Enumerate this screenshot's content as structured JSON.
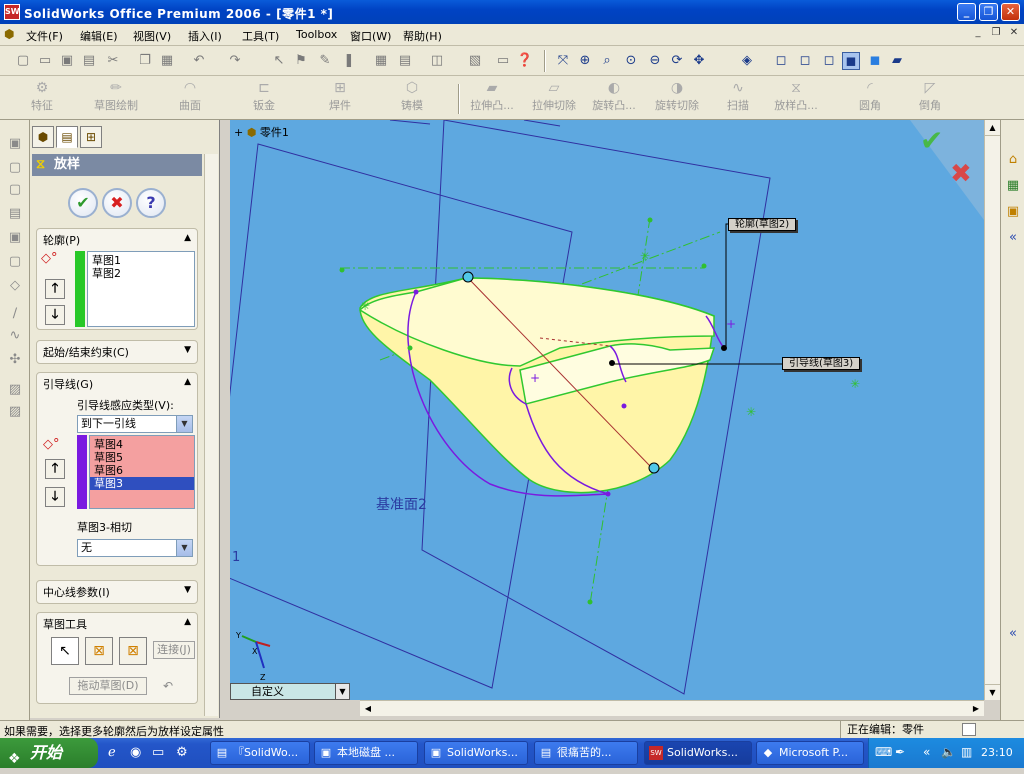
{
  "window": {
    "title": "SolidWorks Office Premium 2006 - [零件1 *]",
    "app_icon": "SW",
    "min": "_",
    "max": "❐",
    "close": "✕"
  },
  "menu": {
    "items": [
      "文件(F)",
      "编辑(E)",
      "视图(V)",
      "插入(I)",
      "工具(T)",
      "Toolbox",
      "窗口(W)",
      "帮助(H)"
    ],
    "mdi_min": "_",
    "mdi_restore": "❐",
    "mdi_close": "✕"
  },
  "features_toolbar": {
    "items": [
      "特征",
      "草图绘制",
      "曲面",
      "钣金",
      "焊件",
      "铸模",
      "拉伸凸...",
      "拉伸切除",
      "旋转凸...",
      "旋转切除",
      "扫描",
      "放样凸...",
      "圆角",
      "倒角"
    ]
  },
  "property_manager": {
    "title": "放样",
    "ok": "✔",
    "cancel": "✖",
    "help": "?",
    "profiles": {
      "label": "轮廓(P)",
      "items": [
        "草图1",
        "草图2"
      ]
    },
    "start_end": {
      "label": "起始/结束约束(C)"
    },
    "guides": {
      "label": "引导线(G)",
      "type_label": "引导线感应类型(V):",
      "type_value": "到下一引线",
      "items": [
        "草图4",
        "草图5",
        "草图6",
        "草图3"
      ],
      "selected_index": 3,
      "tangency_label": "草图3-相切",
      "tangency_value": "无"
    },
    "centerline": {
      "label": "中心线参数(I)"
    },
    "sketch_tools": {
      "label": "草图工具",
      "connect": "连接(J)",
      "drag": "拖动草图(D)"
    }
  },
  "viewport": {
    "tree_root": "零件1",
    "plane_label": "基准面2",
    "edge_label": "1",
    "callout_profile": "轮廓(草图2)",
    "callout_guide": "引导线(草图3)",
    "view_combo": "自定义",
    "triad": {
      "x": "X",
      "y": "Y",
      "z": "Z"
    }
  },
  "statusbar": {
    "left": "如果需要，选择更多轮廓然后为放样设定属性",
    "right": "正在编辑：零件"
  },
  "taskbar": {
    "start": "开始",
    "tasks": [
      "『SolidWo...",
      "本地磁盘 ...",
      "SolidWorks...",
      "很痛苦的...",
      "SolidWorks...",
      "Microsoft P..."
    ],
    "active_index": 4,
    "clock": "23:10"
  },
  "colors": {
    "viewport_bg": "#5ea8e0",
    "surface": "#fff5a8",
    "selected_guide": "#2f4fbf",
    "guide_list_bg": "#f4a0a0"
  }
}
